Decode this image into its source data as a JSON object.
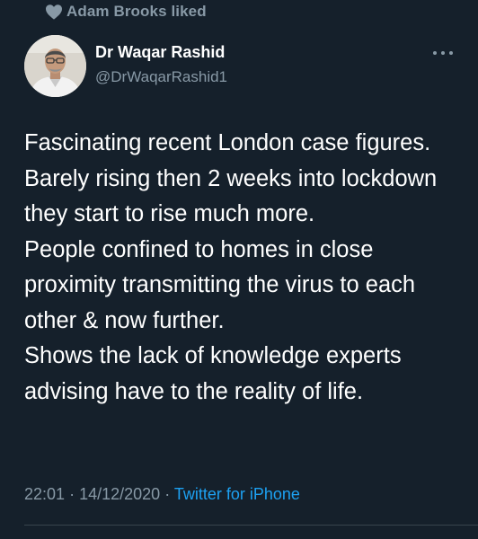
{
  "social_context": {
    "icon": "heart-icon",
    "text": "Adam Brooks liked"
  },
  "author": {
    "display_name": "Dr Waqar Rashid",
    "handle": "@DrWaqarRashid1",
    "avatar": "profile-photo"
  },
  "tweet": {
    "text": "Fascinating recent London case figures.\nBarely rising then 2 weeks into lockdown they start to rise much more.\nPeople confined to homes in close proximity transmitting the virus to each other & now further.\nShows the lack of knowledge experts advising have to the reality of life.",
    "time": "22:01",
    "date": "14/12/2020",
    "separator": "·",
    "source": "Twitter for iPhone"
  },
  "colors": {
    "background": "#15202b",
    "secondary_text": "#8899a6",
    "link": "#1da1f2",
    "divider": "#38444d"
  }
}
